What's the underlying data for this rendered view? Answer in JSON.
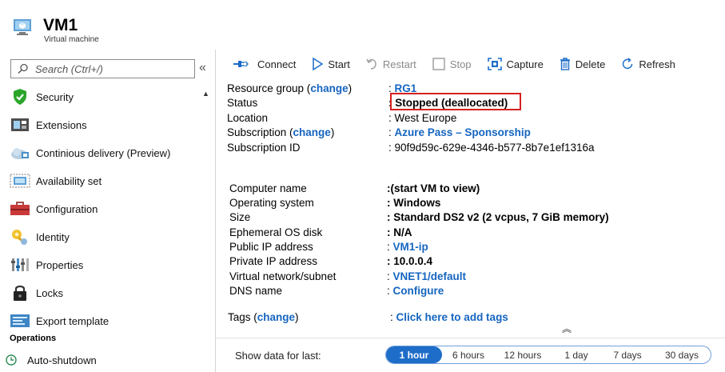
{
  "header": {
    "title": "VM1",
    "subtitle": "Virtual machine"
  },
  "sidebar": {
    "search_placeholder": "Search (Ctrl+/)",
    "collapse_glyph": "«",
    "items": [
      {
        "label": "Security",
        "icon": "shield-check-icon"
      },
      {
        "label": "Extensions",
        "icon": "extensions-icon"
      },
      {
        "label": "Continious delivery (Preview)",
        "icon": "cloud-delivery-icon"
      },
      {
        "label": "Availability set",
        "icon": "availability-set-icon"
      },
      {
        "label": "Configuration",
        "icon": "toolbox-icon"
      },
      {
        "label": "Identity",
        "icon": "identity-key-icon"
      },
      {
        "label": "Properties",
        "icon": "properties-bars-icon"
      },
      {
        "label": "Locks",
        "icon": "lock-icon"
      },
      {
        "label": "Export template",
        "icon": "export-template-icon"
      }
    ],
    "section_operations": "Operations",
    "operations_items": [
      {
        "label": "Auto-shutdown",
        "icon": "clock-icon"
      }
    ]
  },
  "toolbar": {
    "connect": "Connect",
    "start": "Start",
    "restart": "Restart",
    "stop": "Stop",
    "capture": "Capture",
    "delete": "Delete",
    "refresh": "Refresh"
  },
  "essentials": {
    "resource_group_label": "Resource group (",
    "change": "change",
    "close_paren": ")",
    "resource_group_value": "RG1",
    "status_label": "Status",
    "status_value": "Stopped (deallocated)",
    "location_label": "Location",
    "location_value": "West Europe",
    "subscription_label": "Subscription (",
    "subscription_value": "Azure Pass – Sponsorship",
    "subscription_id_label": "Subscription ID",
    "subscription_id_value": "90f9d59c-629e-4346-b577-8b7e1ef1316a",
    "sep": ":"
  },
  "details": {
    "computer_name_label": "Computer name",
    "computer_name_value": "(start VM to view)",
    "os_label": "Operating system",
    "os_value": "Windows",
    "size_label": "Size",
    "size_value": "Standard DS2 v2 (2 vcpus, 7 GiB memory)",
    "ephemeral_label": "Ephemeral OS disk",
    "ephemeral_value": "N/A",
    "public_ip_label": "Public IP address",
    "public_ip_value": "VM1-ip",
    "private_ip_label": "Private IP address",
    "private_ip_value": "10.0.0.4",
    "vnet_label": "Virtual network/subnet",
    "vnet_value": "VNET1/default",
    "dns_label": "DNS name",
    "dns_value": "Configure",
    "tags_label": "Tags (",
    "tags_value": "Click here to add tags"
  },
  "time_filter": {
    "label": "Show data for last:",
    "options": [
      "1 hour",
      "6 hours",
      "12 hours",
      "1 day",
      "7 days",
      "30 days"
    ],
    "selected": "1 hour"
  },
  "colors": {
    "link": "#1565c0",
    "highlight": "#d62020",
    "active_pill": "#1e6dc8"
  }
}
